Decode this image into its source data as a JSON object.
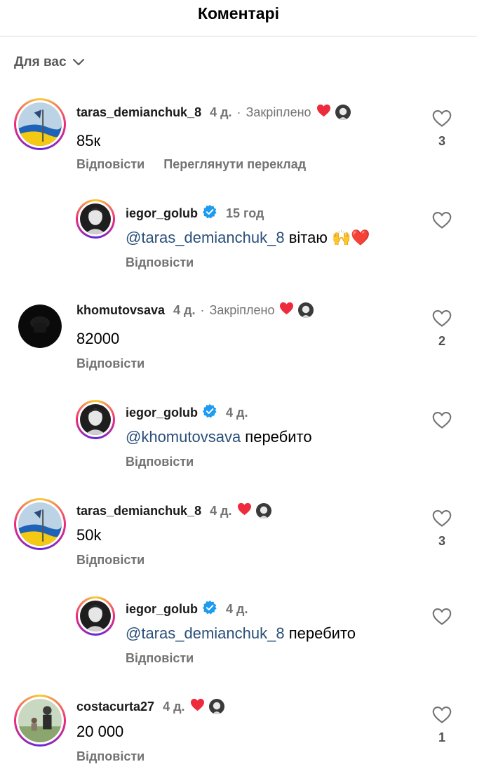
{
  "header": {
    "title": "Коментарі"
  },
  "filter": {
    "label": "Для вас"
  },
  "comments": [
    {
      "username": "taras_demianchuk_8",
      "time": "4 д.",
      "pinned": "Закріплено",
      "text": "85к",
      "reply": "Відповісти",
      "translate": "Переглянути переклад",
      "likes": "3"
    },
    {
      "username": "iegor_golub",
      "time": "15 год",
      "mention": "@taras_demianchuk_8",
      "text": " вітаю 🙌❤️",
      "reply": "Відповісти"
    },
    {
      "username": "khomutovsava",
      "time": "4 д.",
      "pinned": "Закріплено",
      "text": "82000",
      "reply": "Відповісти",
      "likes": "2"
    },
    {
      "username": "iegor_golub",
      "time": "4 д.",
      "mention": "@khomutovsava",
      "text": " перебито",
      "reply": "Відповісти"
    },
    {
      "username": "taras_demianchuk_8",
      "time": "4 д.",
      "text": "50k",
      "reply": "Відповісти",
      "likes": "3"
    },
    {
      "username": "iegor_golub",
      "time": "4 д.",
      "mention": "@taras_demianchuk_8",
      "text": " перебито",
      "reply": "Відповісти"
    },
    {
      "username": "costacurta27",
      "time": "4 д.",
      "text": "20 000",
      "reply": "Відповісти",
      "likes": "1"
    }
  ],
  "separator": "·",
  "icons": {
    "like": "heart-outline-icon",
    "liked_by_author": "heart-filled-icon",
    "verified": "verified-badge-icon",
    "dropdown": "chevron-down-icon"
  },
  "colors": {
    "heart": "#ed2b3d",
    "verified": "#1d9bf0",
    "secondary_text": "#737373",
    "mention": "#2a4f7a"
  }
}
